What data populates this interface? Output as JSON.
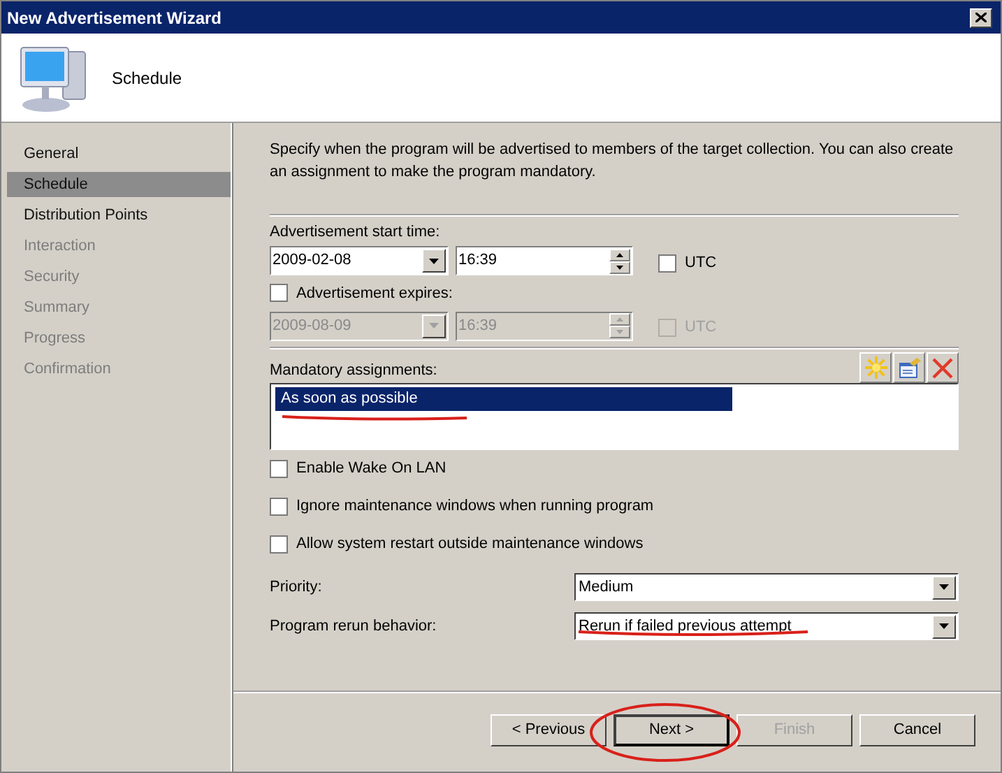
{
  "window": {
    "title": "New Advertisement Wizard"
  },
  "header": {
    "title": "Schedule"
  },
  "sidebar": {
    "items": [
      {
        "label": "General",
        "selected": false,
        "disabled": false
      },
      {
        "label": "Schedule",
        "selected": true,
        "disabled": false
      },
      {
        "label": "Distribution Points",
        "selected": false,
        "disabled": false
      },
      {
        "label": "Interaction",
        "selected": false,
        "disabled": true
      },
      {
        "label": "Security",
        "selected": false,
        "disabled": true
      },
      {
        "label": "Summary",
        "selected": false,
        "disabled": true
      },
      {
        "label": "Progress",
        "selected": false,
        "disabled": true
      },
      {
        "label": "Confirmation",
        "selected": false,
        "disabled": true
      }
    ]
  },
  "description": "Specify when the program will be advertised to members of the target collection. You can also create an assignment to make the program mandatory.",
  "start": {
    "label": "Advertisement start time:",
    "date": "2009-02-08",
    "time": "16:39",
    "utc": {
      "label": "UTC",
      "checked": false
    }
  },
  "expires": {
    "label": "Advertisement expires:",
    "checked": false,
    "date": "2009-08-09",
    "time": "16:39",
    "utc": {
      "label": "UTC",
      "checked": false
    }
  },
  "mandatory": {
    "label": "Mandatory assignments:",
    "items": [
      {
        "label": "As soon as possible",
        "selected": true
      }
    ]
  },
  "options": [
    {
      "label": "Enable Wake On LAN",
      "checked": false
    },
    {
      "label": "Ignore maintenance windows when running program",
      "checked": false
    },
    {
      "label": "Allow system restart outside maintenance windows",
      "checked": false
    }
  ],
  "priority": {
    "label": "Priority:",
    "value": "Medium"
  },
  "rerun": {
    "label": "Program rerun behavior:",
    "value": "Rerun if failed previous attempt"
  },
  "buttons": [
    {
      "label": "< Previous",
      "disabled": false,
      "default": false
    },
    {
      "label": "Next >",
      "disabled": false,
      "default": true
    },
    {
      "label": "Finish",
      "disabled": true,
      "default": false
    },
    {
      "label": "Cancel",
      "disabled": false,
      "default": false
    }
  ]
}
